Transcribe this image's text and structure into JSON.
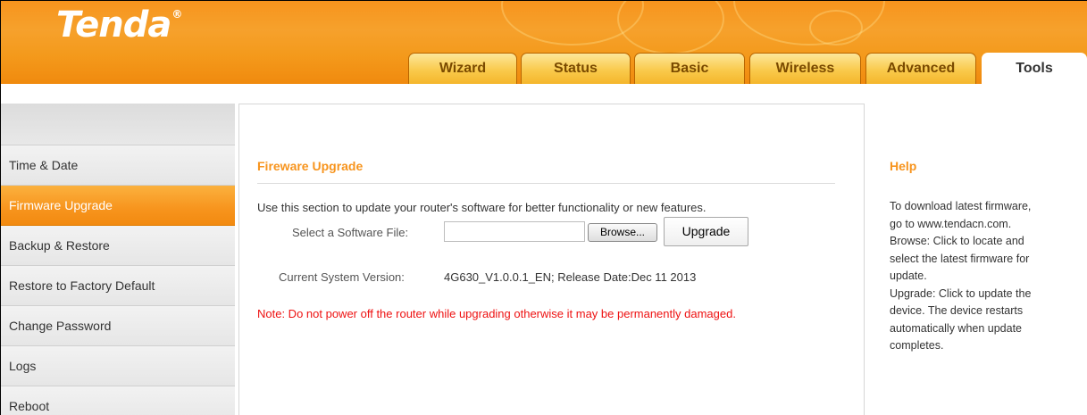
{
  "brand": {
    "logo_text": "Tenda",
    "logo_mark": "®"
  },
  "colors": {
    "accent": "#f7941d",
    "note_red": "#ee1111",
    "tab_text": "#7a4a00"
  },
  "tabs": [
    {
      "label": "Wizard"
    },
    {
      "label": "Status"
    },
    {
      "label": "Basic"
    },
    {
      "label": "Wireless"
    },
    {
      "label": "Advanced"
    },
    {
      "label": "Tools",
      "active": true
    }
  ],
  "sidebar": {
    "items": [
      {
        "label": "Time & Date"
      },
      {
        "label": "Firmware Upgrade",
        "active": true
      },
      {
        "label": "Backup & Restore"
      },
      {
        "label": "Restore to Factory Default"
      },
      {
        "label": "Change Password"
      },
      {
        "label": "Logs"
      },
      {
        "label": "Reboot"
      }
    ]
  },
  "main": {
    "title": "Fireware Upgrade",
    "description": "Use this section to update your router's software for better functionality or new features.",
    "file_label": "Select a Software File:",
    "file_value": "",
    "browse_label": "Browse...",
    "upgrade_label": "Upgrade",
    "version_label": "Current System Version:",
    "version_value": "4G630_V1.0.0.1_EN; Release Date:Dec 11 2013",
    "note": "Note: Do not power off the router while upgrading otherwise it may be permanently damaged."
  },
  "help": {
    "title": "Help",
    "lines": [
      "To download latest firmware,",
      "go to www.tendacn.com.",
      "Browse: Click to locate and",
      "select the latest firmware for",
      "update.",
      "Upgrade: Click to update the",
      "device. The device restarts",
      "automatically when update",
      "completes."
    ]
  }
}
